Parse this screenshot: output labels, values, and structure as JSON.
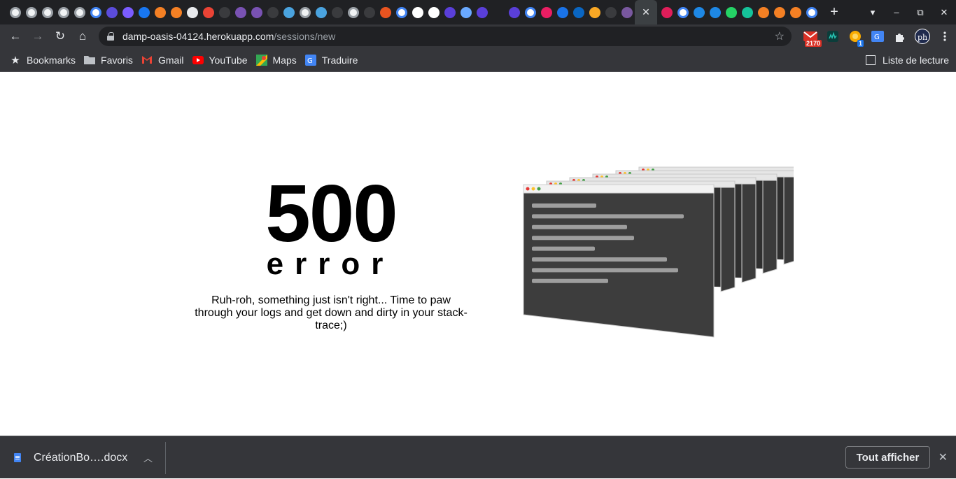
{
  "browser": {
    "tabs": {
      "favicons": [
        "chrome-icon",
        "chrome-icon",
        "chrome-icon",
        "chrome-icon",
        "chrome-icon",
        "google-icon",
        "dribbble-icon",
        "messenger-icon",
        "facebook-icon",
        "stackoverflow-icon",
        "stackoverflow-icon",
        "pen-icon",
        "gmail-icon",
        "github-icon",
        "bootstrap-icon",
        "bootstrap-icon",
        "github-icon",
        "rocket-icon",
        "chrome-icon",
        "rocket-icon",
        "github-icon",
        "chrome-icon",
        "github-icon",
        "ubuntu-icon",
        "google-icon",
        "figma-icon",
        "codepen-icon",
        "mural-icon",
        "globe-icon",
        "mural-icon",
        "blank-icon",
        "mural-icon",
        "google-icon",
        "mountain-icon",
        "crown-icon",
        "linkedin-icon",
        "flame-icon",
        "github-icon",
        "heroku-icon"
      ],
      "active_close": "✕",
      "after_active": [
        "slack-icon",
        "google-icon",
        "c-icon",
        "c-icon",
        "whatsapp-icon",
        "grammarly-icon",
        "stackoverflow-icon",
        "stackoverflow-icon",
        "stackoverflow-icon",
        "google-icon"
      ],
      "new_tab": "+"
    },
    "window_controls": {
      "menu": "▾",
      "minimize": "–",
      "restore": "⧉",
      "close": "✕"
    },
    "nav": {
      "back": "←",
      "forward": "→",
      "reload": "↻",
      "home": "⌂"
    },
    "address": {
      "host": "damp-oasis-04124.herokuapp.com",
      "path": "/sessions/new"
    },
    "extensions": {
      "gmail_badge": "2170",
      "translate_badge": "1"
    },
    "bookmarks": [
      {
        "label": "Bookmarks",
        "icon": "star-icon"
      },
      {
        "label": "Favoris",
        "icon": "folder-icon"
      },
      {
        "label": "Gmail",
        "icon": "gmail-icon"
      },
      {
        "label": "YouTube",
        "icon": "youtube-icon"
      },
      {
        "label": "Maps",
        "icon": "maps-icon"
      },
      {
        "label": "Traduire",
        "icon": "translate-icon"
      }
    ],
    "reading_list": "Liste de lecture"
  },
  "page": {
    "error_code": "500",
    "error_word": "error",
    "message": "Ruh-roh, something just isn't right... Time to paw through your logs and get down and dirty in your stack-trace;)"
  },
  "downloads": {
    "file": "CréationBo….docx",
    "show_all": "Tout afficher",
    "close": "✕"
  }
}
